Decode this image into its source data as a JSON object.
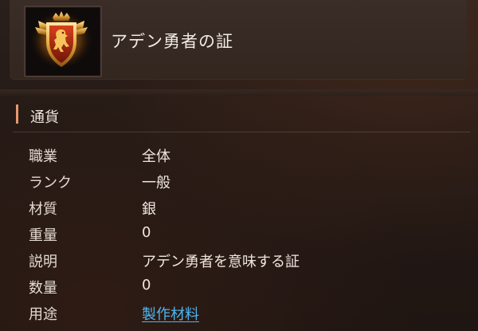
{
  "item": {
    "title": "アデン勇者の証",
    "icon": "lion-shield-emblem-icon"
  },
  "section": {
    "label": "通貨"
  },
  "properties": [
    {
      "key": "職業",
      "value": "全体"
    },
    {
      "key": "ランク",
      "value": "一般"
    },
    {
      "key": "材質",
      "value": "銀"
    },
    {
      "key": "重量",
      "value": "0"
    },
    {
      "key": "説明",
      "value": "アデン勇者を意味する証"
    },
    {
      "key": "数量",
      "value": "0"
    },
    {
      "key": "用途",
      "value": "製作材料"
    }
  ],
  "colors": {
    "accent_bar": "#e59a6d",
    "link": "#4cb6f2",
    "background": "#231915"
  }
}
